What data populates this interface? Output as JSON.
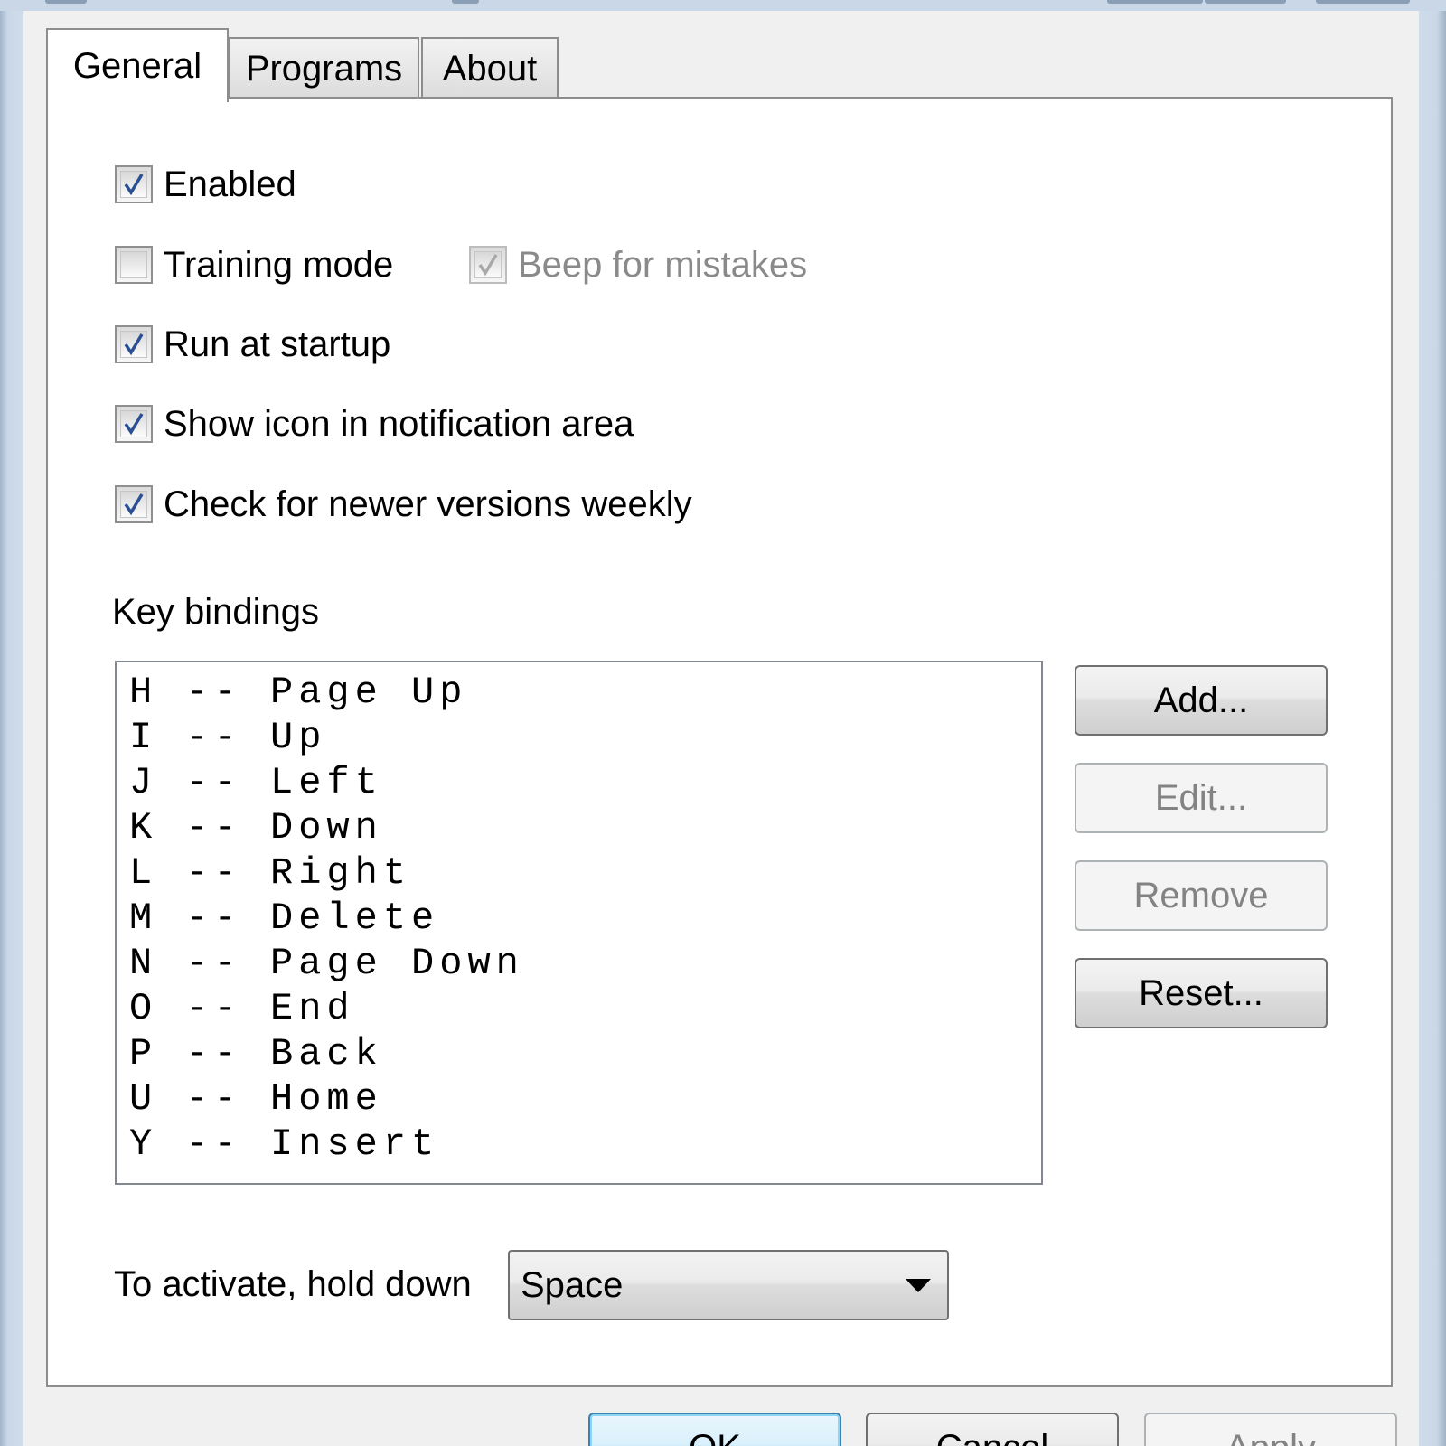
{
  "tabs": [
    {
      "label": "General",
      "active": true
    },
    {
      "label": "Programs",
      "active": false
    },
    {
      "label": "About",
      "active": false
    }
  ],
  "options": {
    "enabled": {
      "label": "Enabled",
      "checked": true,
      "disabled": false
    },
    "training_mode": {
      "label": "Training mode",
      "checked": false,
      "disabled": false
    },
    "beep_for_mistakes": {
      "label": "Beep for mistakes",
      "checked": true,
      "disabled": true
    },
    "run_at_startup": {
      "label": "Run at startup",
      "checked": true,
      "disabled": false
    },
    "show_icon": {
      "label": "Show icon in notification area",
      "checked": true,
      "disabled": false
    },
    "check_updates": {
      "label": "Check for newer versions weekly",
      "checked": true,
      "disabled": false
    }
  },
  "key_bindings": {
    "label": "Key bindings",
    "items": [
      "H -- Page Up",
      "I -- Up",
      "J -- Left",
      "K -- Down",
      "L -- Right",
      "M -- Delete",
      "N -- Page Down",
      "O -- End",
      "P -- Back",
      "U -- Home",
      "Y -- Insert"
    ],
    "buttons": {
      "add": "Add...",
      "edit": "Edit...",
      "remove": "Remove",
      "reset": "Reset..."
    }
  },
  "activation": {
    "label": "To activate, hold down",
    "selected": "Space"
  },
  "dialog_buttons": {
    "ok": "OK",
    "cancel": "Cancel",
    "apply": "Apply"
  },
  "icons": {
    "checkmark": "checkmark-icon",
    "dropdown": "chevron-down-icon"
  }
}
